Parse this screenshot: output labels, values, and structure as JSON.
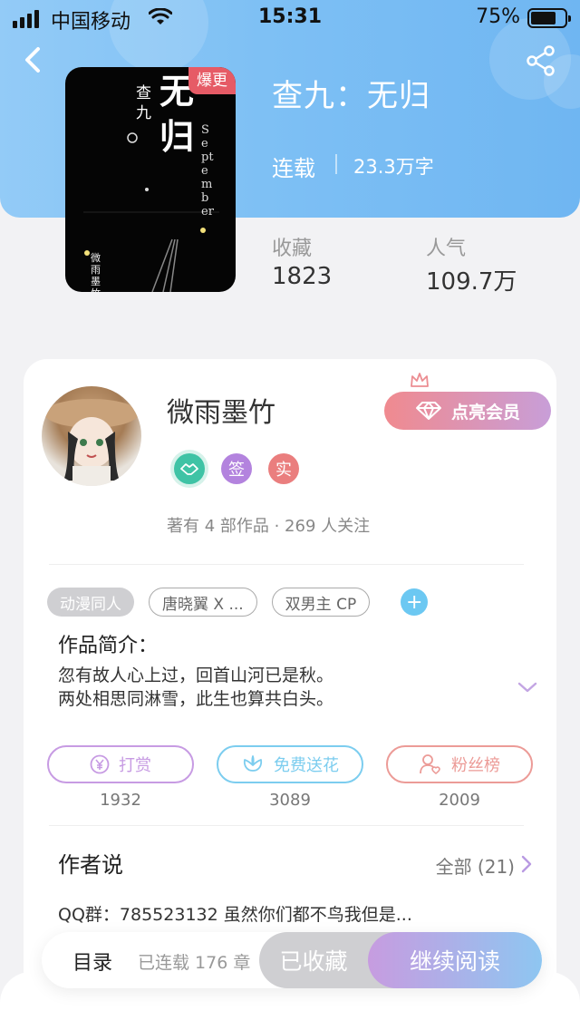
{
  "status_bar": {
    "carrier": "中国移动",
    "time": "15:31",
    "battery_percent": "75%",
    "battery_level": 0.75
  },
  "nav": {
    "back_icon": "chevron-left-icon",
    "share_icon": "share-icon"
  },
  "book": {
    "cover_title": "无归",
    "cover_author": "查九",
    "cover_english": "September",
    "cover_subauthor": "微雨墨竹",
    "hot_badge": "爆更",
    "title": "查九：无归",
    "status": "连载",
    "word_count": "23.3万字",
    "favorites_label": "收藏",
    "favorites_value": "1823",
    "popularity_label": "人气",
    "popularity_value": "109.7万"
  },
  "author": {
    "name": "微雨墨竹",
    "vip_button": "点亮会员",
    "badges": [
      {
        "icon": "handshake-icon",
        "text": "",
        "color": "#3fc3a5"
      },
      {
        "icon": "signed-icon",
        "text": "签",
        "color": "#b383de"
      },
      {
        "icon": "verified-icon",
        "text": "实",
        "color": "#ea7e7e"
      }
    ],
    "meta": "著有 4 部作品 · 269 人关注"
  },
  "tags": [
    {
      "label": "动漫同人",
      "style": "filled"
    },
    {
      "label": "唐晓翼 X ...",
      "style": "outline"
    },
    {
      "label": "双男主 CP",
      "style": "outline"
    }
  ],
  "intro": {
    "title": "作品简介：",
    "line1": "忽有故人心上过，回首山河已是秋。",
    "line2": "两处相思同淋雪，此生也算共白头。"
  },
  "actions": [
    {
      "label": "打赏",
      "count": "1932",
      "color": "#c79be3",
      "icon": "yen-icon"
    },
    {
      "label": "免费送花",
      "count": "3089",
      "color": "#7ccdef",
      "icon": "flower-icon"
    },
    {
      "label": "粉丝榜",
      "count": "2009",
      "color": "#ec9b97",
      "icon": "fan-icon"
    }
  ],
  "author_said": {
    "title": "作者说",
    "all_label": "全部 (21)",
    "text": "QQ群：785523132  虽然你们都不鸟我但是..."
  },
  "bottom_bar": {
    "toc_label": "目录",
    "toc_count": "已连载 176 章",
    "favorited_label": "已收藏",
    "continue_label": "继续阅读"
  },
  "colors": {
    "header_gradient_start": "#93cbf7",
    "header_gradient_end": "#6fb6f2",
    "hot_badge": "#e65b66",
    "tag_add": "#6cc8f2"
  }
}
